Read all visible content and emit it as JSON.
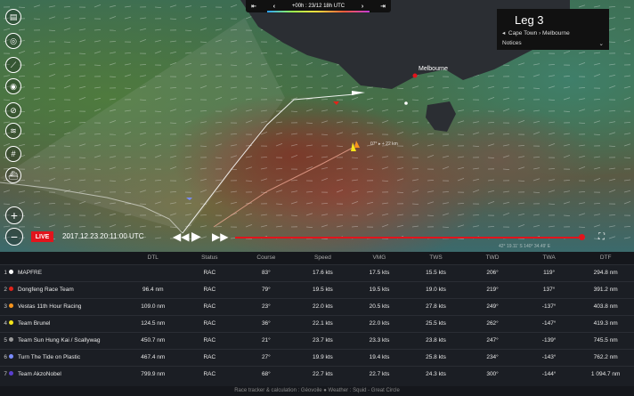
{
  "timebar": {
    "rewind": "⇤",
    "back": "‹",
    "label": "+00h : 23/12 18h UTC",
    "fwd": "›",
    "end": "⇥"
  },
  "leg": {
    "title": "Leg 3",
    "route": "Cape Town › Melbourne",
    "notices": "Notices"
  },
  "map": {
    "city": "Melbourne",
    "annotation": "07°  ▸  + 22 km",
    "coords": "42° 19.11' S   140° 34.49' E"
  },
  "playback": {
    "live": "LIVE",
    "datetime": "2017.12.23 20:11:00 UTC",
    "progress": 0.99
  },
  "columns": [
    "",
    "",
    "",
    "DTL",
    "Status",
    "Course",
    "Speed",
    "VMG",
    "TWS",
    "TWD",
    "TWA",
    "DTF"
  ],
  "teams": [
    {
      "rank": "1",
      "color": "#ffffff",
      "name": "MAPFRE",
      "dtl": "",
      "status": "RAC",
      "course": "83°",
      "speed": "17.6 kts",
      "vmg": "17.5 kts",
      "tws": "15.5 kts",
      "twd": "206°",
      "twa": "119°",
      "dtf": "294.8 nm"
    },
    {
      "rank": "2",
      "color": "#e2231a",
      "name": "Dongfeng Race Team",
      "dtl": "96.4 nm",
      "status": "RAC",
      "course": "79°",
      "speed": "19.5 kts",
      "vmg": "19.5 kts",
      "tws": "19.0 kts",
      "twd": "219°",
      "twa": "137°",
      "dtf": "391.2 nm"
    },
    {
      "rank": "3",
      "color": "#f7941d",
      "name": "Vestas 11th Hour Racing",
      "dtl": "109.0 nm",
      "status": "RAC",
      "course": "23°",
      "speed": "22.0 kts",
      "vmg": "20.5 kts",
      "tws": "27.8 kts",
      "twd": "249°",
      "twa": "-137°",
      "dtf": "403.8 nm"
    },
    {
      "rank": "4",
      "color": "#f5e51a",
      "name": "Team Brunel",
      "dtl": "124.5 nm",
      "status": "RAC",
      "course": "36°",
      "speed": "22.1 kts",
      "vmg": "22.0 kts",
      "tws": "25.5 kts",
      "twd": "262°",
      "twa": "-147°",
      "dtf": "419.3 nm"
    },
    {
      "rank": "5",
      "color": "#9a9a9a",
      "name": "Team Sun Hung Kai / Scallywag",
      "dtl": "450.7 nm",
      "status": "RAC",
      "course": "21°",
      "speed": "23.7 kts",
      "vmg": "23.3 kts",
      "tws": "23.8 kts",
      "twd": "247°",
      "twa": "-139°",
      "dtf": "745.5 nm"
    },
    {
      "rank": "6",
      "color": "#7a8cff",
      "name": "Turn The Tide on Plastic",
      "dtl": "467.4 nm",
      "status": "RAC",
      "course": "27°",
      "speed": "19.9 kts",
      "vmg": "19.4 kts",
      "tws": "25.8 kts",
      "twd": "234°",
      "twa": "-143°",
      "dtf": "762.2 nm"
    },
    {
      "rank": "7",
      "color": "#5a3fd0",
      "name": "Team AkzoNobel",
      "dtl": "799.9 nm",
      "status": "RAC",
      "course": "68°",
      "speed": "22.7 kts",
      "vmg": "22.7 kts",
      "tws": "24.3 kts",
      "twd": "300°",
      "twa": "-144°",
      "dtf": "1 094.7 nm"
    }
  ],
  "footer": "Race tracker & calculation : Géovoile  ●  Weather : Squid - Great Circle",
  "icons": {
    "tools": [
      "book-icon",
      "globe-icon",
      "ruler-icon",
      "radar-icon",
      "compass-icon",
      "wind-icon",
      "grid-icon",
      "ship-icon"
    ],
    "zoom": [
      "zoom-in-icon",
      "zoom-out-icon"
    ]
  }
}
